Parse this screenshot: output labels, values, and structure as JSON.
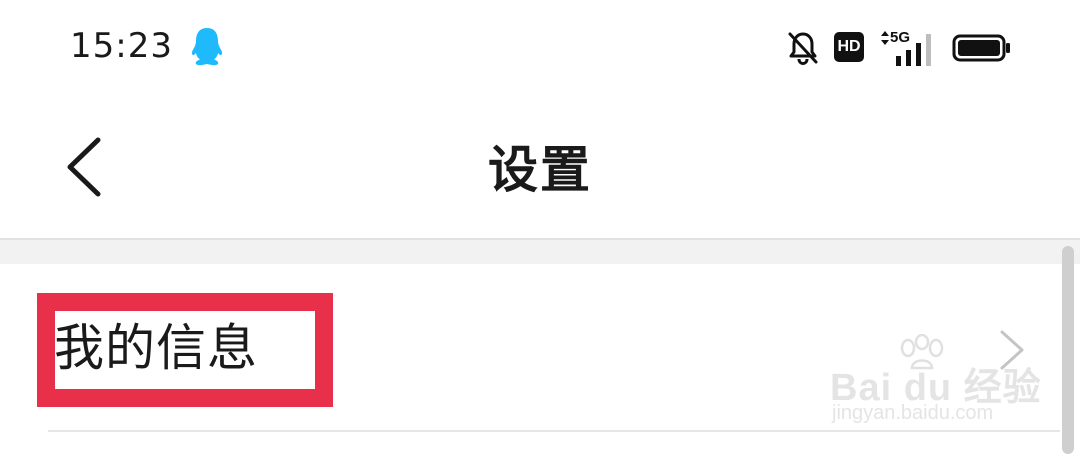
{
  "status_bar": {
    "time": "15:23",
    "network_type": "5G",
    "hd_label": "HD",
    "icons": [
      "qq-icon",
      "bell-off-icon",
      "hd-icon",
      "signal-icon",
      "battery-icon"
    ]
  },
  "nav": {
    "title": "设置",
    "back_icon": "chevron-left-icon"
  },
  "settings": {
    "items": [
      {
        "label": "我的信息",
        "icon": "chevron-right-icon"
      }
    ]
  },
  "watermark": {
    "text": "Bai du 经验",
    "sub": "jingyan.baidu.com"
  },
  "colors": {
    "highlight": "#e8304a",
    "qq_blue": "#1ebafc",
    "text": "#1a1a1a",
    "gap": "#f2f2f2"
  }
}
